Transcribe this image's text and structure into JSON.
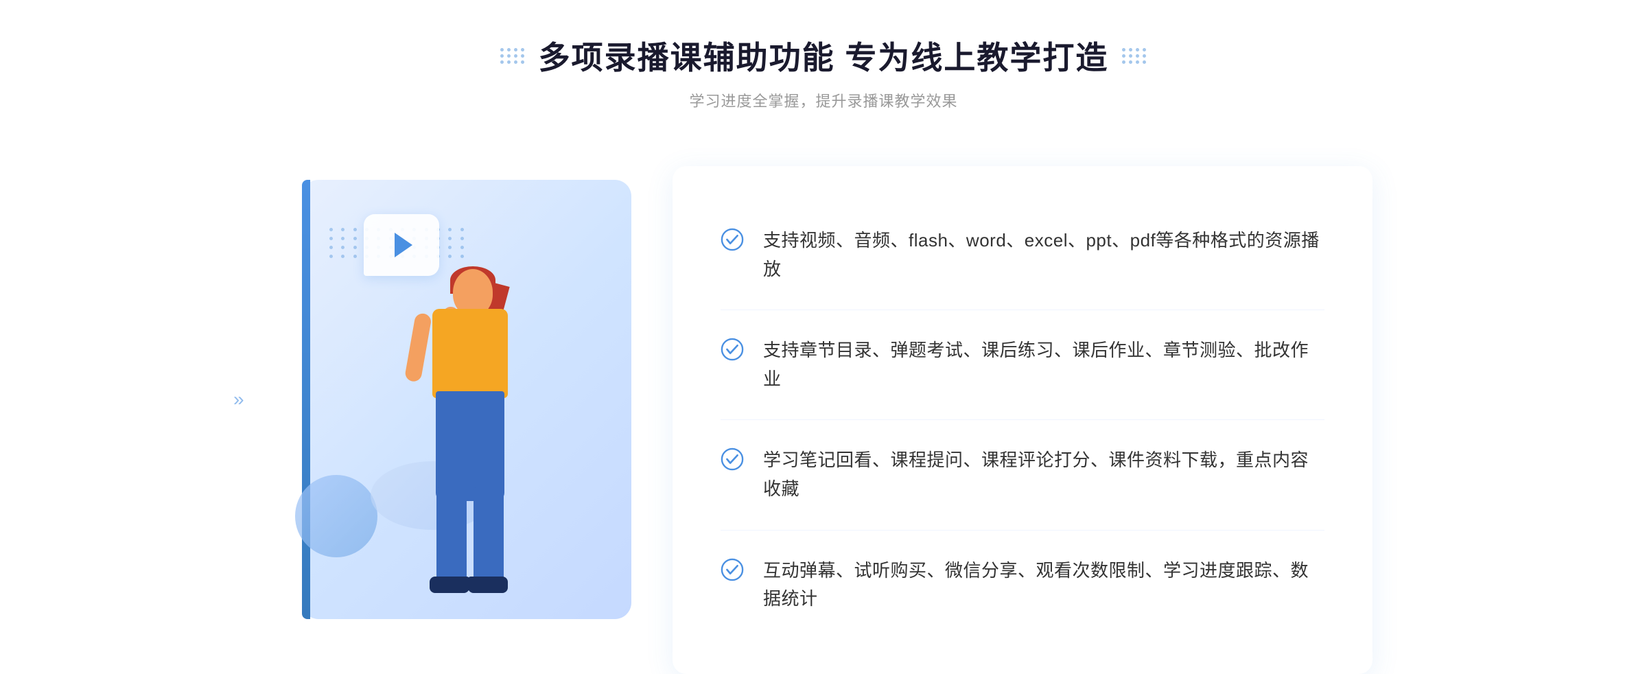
{
  "header": {
    "title": "多项录播课辅助功能 专为线上教学打造",
    "subtitle": "学习进度全掌握，提升录播课教学效果"
  },
  "features": [
    {
      "id": "feature-1",
      "text": "支持视频、音频、flash、word、excel、ppt、pdf等各种格式的资源播放"
    },
    {
      "id": "feature-2",
      "text": "支持章节目录、弹题考试、课后练习、课后作业、章节测验、批改作业"
    },
    {
      "id": "feature-3",
      "text": "学习笔记回看、课程提问、课程评论打分、课件资料下载，重点内容收藏"
    },
    {
      "id": "feature-4",
      "text": "互动弹幕、试听购买、微信分享、观看次数限制、学习进度跟踪、数据统计"
    }
  ],
  "colors": {
    "primary": "#4a90e2",
    "title": "#1a1a2e",
    "text": "#333333",
    "subtitle": "#999999",
    "check": "#4a90e2"
  }
}
